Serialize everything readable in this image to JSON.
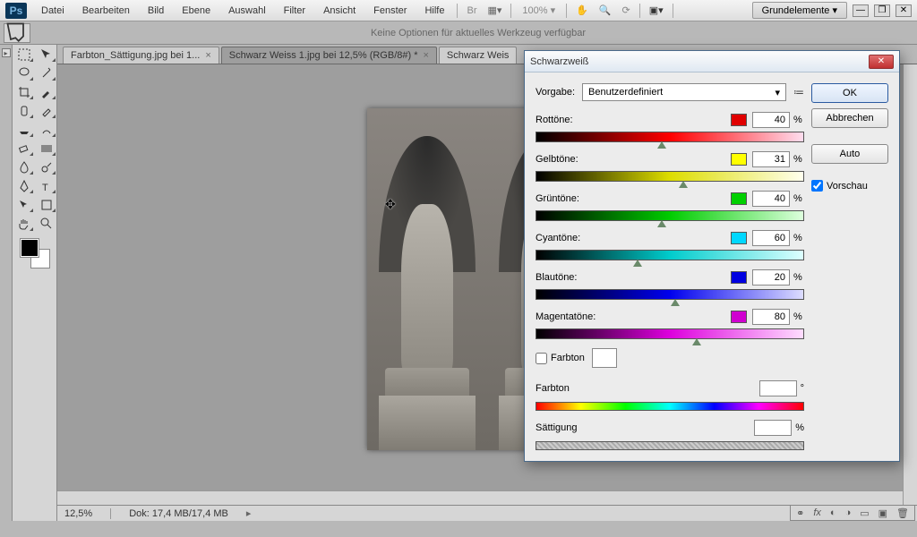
{
  "app": {
    "name": "Ps"
  },
  "menu": [
    "Datei",
    "Bearbeiten",
    "Bild",
    "Ebene",
    "Auswahl",
    "Filter",
    "Ansicht",
    "Fenster",
    "Hilfe"
  ],
  "zoom_display": "100% ▾",
  "workspace_selector": "Grundelemente ▾",
  "options_bar": {
    "no_options": "Keine Optionen für aktuelles Werkzeug verfügbar"
  },
  "tabs": [
    {
      "label": "Farbton_Sättigung.jpg bei 1...",
      "active": false
    },
    {
      "label": "Schwarz Weiss 1.jpg bei 12,5% (RGB/8#) *",
      "active": true
    },
    {
      "label": "Schwarz Weis",
      "active": false
    }
  ],
  "status": {
    "zoom": "12,5%",
    "doc": "Dok: 17,4 MB/17,4 MB"
  },
  "dialog": {
    "title": "Schwarzweiß",
    "preset_label": "Vorgabe:",
    "preset_value": "Benutzerdefiniert",
    "buttons": {
      "ok": "OK",
      "cancel": "Abbrechen",
      "auto": "Auto"
    },
    "preview_label": "Vorschau",
    "preview_checked": true,
    "colors": [
      {
        "label": "Rottöne:",
        "swatch": "#e00000",
        "value": 40,
        "grad": [
          "#000",
          "#f00",
          "#fde"
        ],
        "pos": 47
      },
      {
        "label": "Gelbtöne:",
        "swatch": "#ffff00",
        "value": 31,
        "grad": [
          "#000",
          "#dd0",
          "#ffe"
        ],
        "pos": 55
      },
      {
        "label": "Grüntöne:",
        "swatch": "#00d000",
        "value": 40,
        "grad": [
          "#000",
          "#0c0",
          "#dfd"
        ],
        "pos": 47
      },
      {
        "label": "Cyantöne:",
        "swatch": "#00d8ff",
        "value": 60,
        "grad": [
          "#000",
          "#0cc",
          "#dff"
        ],
        "pos": 38
      },
      {
        "label": "Blautöne:",
        "swatch": "#0000e0",
        "value": 20,
        "grad": [
          "#000",
          "#00e",
          "#ddf"
        ],
        "pos": 52
      },
      {
        "label": "Magentatöne:",
        "swatch": "#d000d0",
        "value": 80,
        "grad": [
          "#000",
          "#d0d",
          "#fdf"
        ],
        "pos": 60
      }
    ],
    "tint_label": "Farbton",
    "hue_label": "Farbton",
    "hue_unit": "°",
    "sat_label": "Sättigung",
    "sat_unit": "%"
  },
  "chart_data": {
    "type": "table",
    "title": "Schwarzweiß adjustment values",
    "categories": [
      "Rottöne",
      "Gelbtöne",
      "Grüntöne",
      "Cyantöne",
      "Blautöne",
      "Magentatöne"
    ],
    "values": [
      40,
      31,
      40,
      60,
      20,
      80
    ],
    "unit": "%"
  }
}
